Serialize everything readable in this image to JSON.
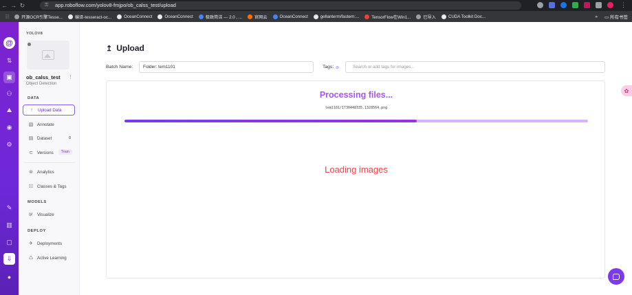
{
  "browser": {
    "url": "app.roboflow.com/yolov8-fmjpo/ob_calss_test/upload",
    "bookmarks": [
      {
        "label": "开源OCR引擎Tesse...",
        "color": "#9aa0a6"
      },
      {
        "label": "编译-tesseract-oc...",
        "color": "#e8eaed"
      },
      {
        "label": "OceanConnect",
        "color": "#e8eaed"
      },
      {
        "label": "OceanConnect",
        "color": "#e8eaed"
      },
      {
        "label": "极致简洁 — 2.0 , ...",
        "color": "#4285f4"
      },
      {
        "label": "官网云",
        "color": "#ff6d00"
      },
      {
        "label": "OceanConnect",
        "color": "#4285f4"
      },
      {
        "label": "gellanterm/fastern:...",
        "color": "#e8eaed"
      },
      {
        "label": "TensorFlow在Win1...",
        "color": "#ea4335"
      },
      {
        "label": "已导入",
        "color": "#9aa0a6"
      },
      {
        "label": "CUDA Toolkit Doc...",
        "color": "#e8eaed"
      }
    ],
    "bookmarks_more": "»",
    "all_bookmarks": "所有书签"
  },
  "rail": {
    "logo": "@",
    "items": [
      {
        "icon": "⇅"
      },
      {
        "icon": "▣"
      },
      {
        "icon": "⚇"
      },
      {
        "icon": "⛰"
      },
      {
        "icon": "◉"
      },
      {
        "icon": "⚙"
      },
      {
        "icon": "✎"
      },
      {
        "icon": "▥"
      },
      {
        "icon": "▢"
      },
      {
        "icon": "⇩"
      },
      {
        "icon": "●"
      }
    ]
  },
  "sidebar": {
    "workspace": "YOLOV8",
    "project_name": "ob_calss_test",
    "project_more": "⋮",
    "project_type": "Object Detection",
    "sections": {
      "data": "DATA",
      "models": "MODELS",
      "deploy": "DEPLOY"
    },
    "items": {
      "upload": {
        "icon": "↑",
        "label": "Upload Data"
      },
      "annotate": {
        "icon": "▧",
        "label": "Annotate"
      },
      "dataset": {
        "icon": "▤",
        "label": "Dataset",
        "count": "0"
      },
      "versions": {
        "icon": "⊂",
        "label": "Versions",
        "badge": "Train"
      },
      "analytics": {
        "icon": "⊜",
        "label": "Analytics"
      },
      "classes": {
        "icon": "☷",
        "label": "Classes & Tags"
      },
      "visualize": {
        "icon": "⊯",
        "label": "Visualize"
      },
      "deployments": {
        "icon": "✈",
        "label": "Deployments"
      },
      "active_learning": {
        "icon": "♺",
        "label": "Active Learning"
      }
    }
  },
  "main": {
    "title_icon": "↥",
    "title": "Upload",
    "batch_label": "Batch Name:",
    "batch_value": "Folder: tem1101",
    "tags_label": "Tags:",
    "tags_icon": "⊘",
    "tags_placeholder": "Search or add tags for images...",
    "processing": "Processing files...",
    "current_file": "tem1101/1730448335.1328564.png",
    "progress": 0.63,
    "loading": "Loading images",
    "side_tab_icon": "✿"
  },
  "colors": {
    "accent": "#7c3aed",
    "processing_text": "#a855f7",
    "loading_text": "#ef4444"
  }
}
